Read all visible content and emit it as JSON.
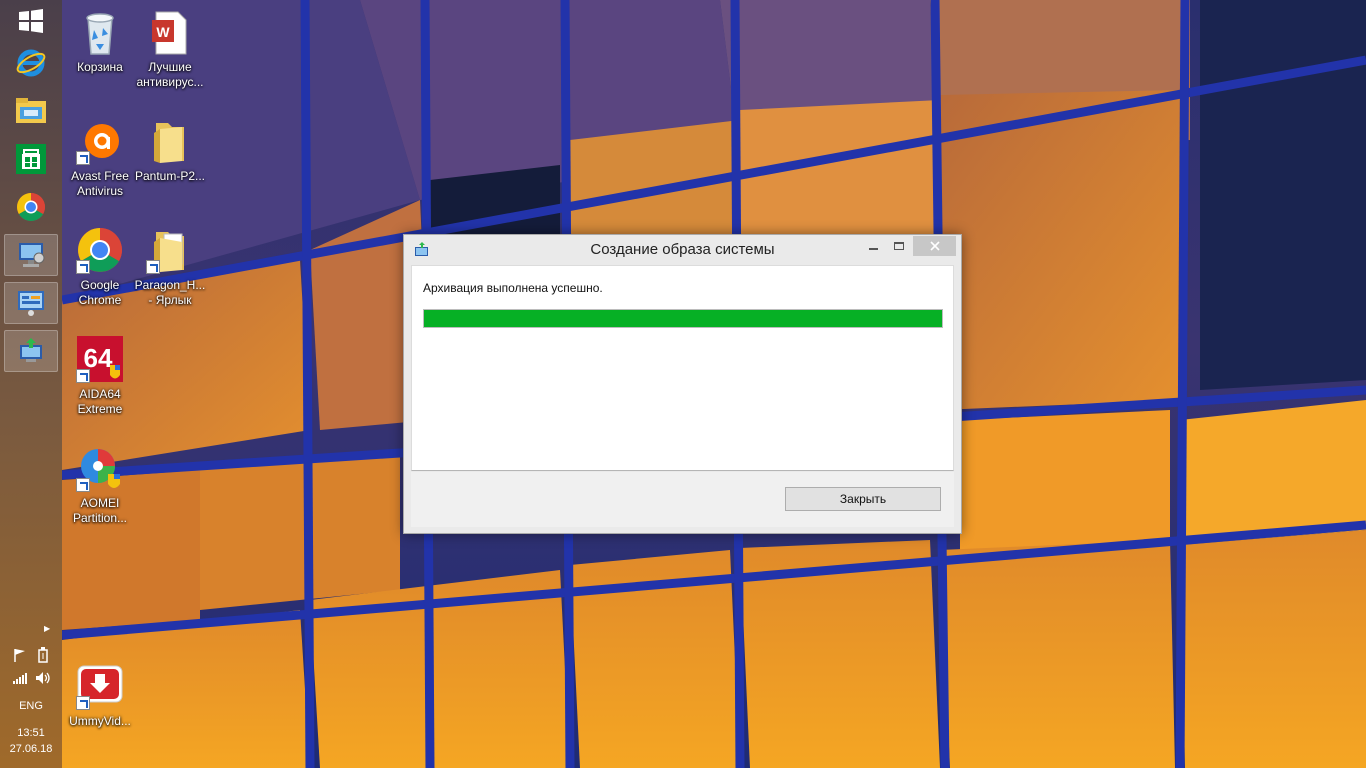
{
  "taskbar": {
    "pinned": [
      {
        "name": "start-button",
        "icon": "windows-logo-icon"
      },
      {
        "name": "internet-explorer",
        "icon": "internet-explorer-icon"
      },
      {
        "name": "file-explorer",
        "icon": "file-explorer-icon"
      },
      {
        "name": "store",
        "icon": "store-icon"
      },
      {
        "name": "chrome",
        "icon": "chrome-icon"
      },
      {
        "name": "system-window-1",
        "icon": "computer-icon"
      },
      {
        "name": "system-window-2",
        "icon": "control-panel-icon"
      },
      {
        "name": "system-window-3",
        "icon": "backup-icon"
      }
    ],
    "tray": {
      "language": "ENG",
      "time": "13:51",
      "date": "27.06.18"
    }
  },
  "desktop": {
    "icons": [
      {
        "label": "Корзина",
        "icon": "recycle-bin-icon"
      },
      {
        "label": "Лучшие антивирус...",
        "icon": "document-icon"
      },
      {
        "label": "Avast Free Antivirus",
        "icon": "avast-icon"
      },
      {
        "label": "Pantum-P2...",
        "icon": "folder-icon"
      },
      {
        "label": "Google Chrome",
        "icon": "chrome-icon"
      },
      {
        "label": "Paragon_H... - Ярлык",
        "icon": "folder-icon"
      },
      {
        "label": "AIDA64 Extreme",
        "icon": "aida64-icon"
      },
      {
        "label": "AOMEI Partition...",
        "icon": "aomei-icon"
      },
      {
        "label": "UmmyVid...",
        "icon": "ummy-icon"
      }
    ]
  },
  "dialog": {
    "title": "Создание образа системы",
    "status": "Архивация выполнена успешно.",
    "progress": 1.0,
    "progress_color": "#06b025",
    "close_button": "Закрыть"
  }
}
